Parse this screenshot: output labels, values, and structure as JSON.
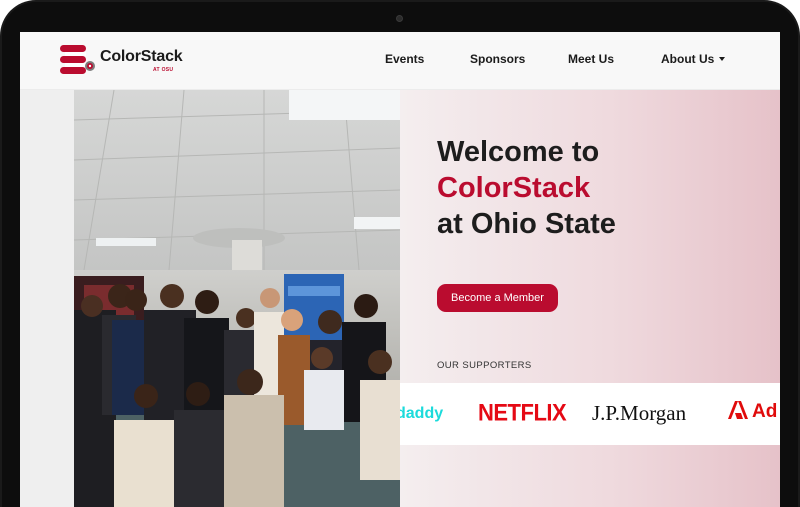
{
  "nav": {
    "logo_text": "ColorStack",
    "logo_sub": "AT OSU",
    "items": [
      {
        "label": "Events"
      },
      {
        "label": "Sponsors"
      },
      {
        "label": "Meet Us"
      },
      {
        "label": "About Us"
      }
    ]
  },
  "hero": {
    "line1": "Welcome to",
    "line2": "ColorStack",
    "line3": "at Ohio State",
    "cta_label": "Become a Member",
    "supporters_label": "OUR SUPPORTERS"
  },
  "supporters": {
    "godaddy": "daddy",
    "netflix": "NETFLIX",
    "jpmorgan": "J.P.Morgan",
    "adobe": "Ad"
  },
  "colors": {
    "brand_red": "#ba0c2f",
    "hero_gradient_end": "#e6c2c9"
  },
  "icons": {
    "logo": "colorstack-logo-icon",
    "caret": "caret-down-icon"
  }
}
